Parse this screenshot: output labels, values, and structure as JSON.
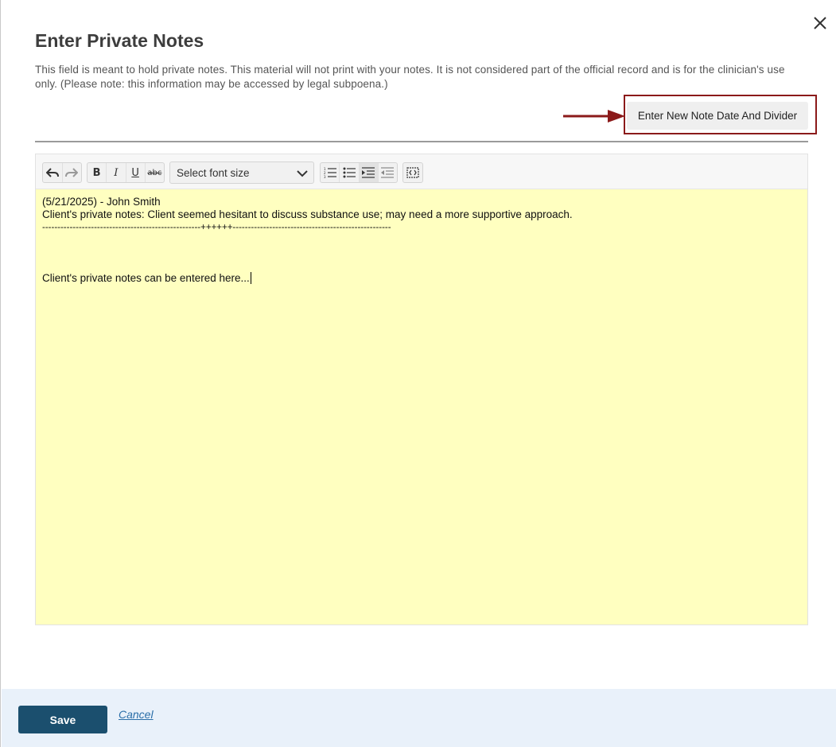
{
  "dialog": {
    "title": "Enter Private Notes",
    "description": "This field is meant to hold private notes. This material will not print with your notes. It is not considered part of the official record and is for the clinician's use only. (Please note: this information may be accessed by legal subpoena.)",
    "close_icon": "close-icon",
    "new_note_button": "Enter New Note Date And Divider",
    "highlight_color": "#8b1a1a"
  },
  "toolbar": {
    "undo_icon": "undo-icon",
    "redo_icon": "redo-icon",
    "bold": "B",
    "italic": "I",
    "underline": "U",
    "strikethrough": "abc",
    "font_size_placeholder": "Select font size",
    "ordered_list_icon": "ordered-list-icon",
    "unordered_list_icon": "unordered-list-icon",
    "indent_icon": "indent-icon",
    "outdent_icon": "outdent-icon",
    "source_icon": "view-source-icon"
  },
  "editor": {
    "background": "#ffffc0",
    "lines": [
      "(5/21/2025) - John Smith",
      "Client's private notes: Client seemed hesitant to discuss substance use; may need a more supportive approach.",
      "----------------------------------------------------++++++----------------------------------------------------",
      "",
      "",
      "",
      "Client's private notes can be entered here..."
    ]
  },
  "footer": {
    "save_label": "Save",
    "cancel_label": "Cancel",
    "save_color": "#1b4f6e"
  }
}
